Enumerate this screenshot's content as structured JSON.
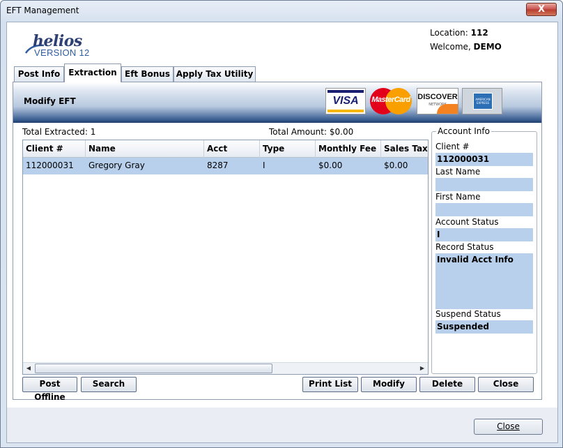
{
  "window": {
    "title": "EFT Management",
    "close_glyph": "X"
  },
  "header": {
    "logo_text": "helios",
    "logo_version": "VERSION 12",
    "location_label": "Location:",
    "location_value": "112",
    "welcome_label": "Welcome,",
    "welcome_value": "DEMO"
  },
  "tabs": [
    {
      "label": "Post Info"
    },
    {
      "label": "Extraction"
    },
    {
      "label": "Eft Bonus"
    },
    {
      "label": "Apply Tax Utility"
    }
  ],
  "active_tab": "Extraction",
  "banner": {
    "title": "Modify EFT",
    "cards": [
      "VISA",
      "MasterCard",
      "DISCOVER",
      "AMERICAN EXPRESS"
    ],
    "discover_sub": "NETWORK"
  },
  "summary": {
    "total_extracted_label": "Total Extracted:",
    "total_extracted_value": "1",
    "total_amount_label": "Total Amount:",
    "total_amount_value": "$0.00"
  },
  "grid": {
    "columns": [
      "Client #",
      "Name",
      "Acct",
      "Type",
      "Monthly Fee",
      "Sales Tax"
    ],
    "rows": [
      [
        "112000031",
        "Gregory Gray",
        "8287",
        "I",
        "$0.00",
        "$0.00"
      ]
    ]
  },
  "account_info": {
    "legend": "Account Info",
    "client_label": "Client #",
    "client_value": "112000031",
    "last_name_label": "Last Name",
    "last_name_value": "",
    "first_name_label": "First Name",
    "first_name_value": "",
    "account_status_label": "Account Status",
    "account_status_value": "I",
    "record_status_label": "Record Status",
    "record_status_value": "Invalid Acct Info",
    "suspend_status_label": "Suspend Status",
    "suspend_status_value": "Suspended"
  },
  "buttons": {
    "post_offline": "Post Offline",
    "search": "Search",
    "print_list": "Print List",
    "modify": "Modify",
    "delete": "Delete",
    "close": "Close"
  },
  "footer": {
    "close_label": "Close"
  },
  "colors": {
    "selection": "#b8d0ec",
    "banner_dark": "#1e3c6b",
    "logo_blue": "#2d3f73"
  }
}
